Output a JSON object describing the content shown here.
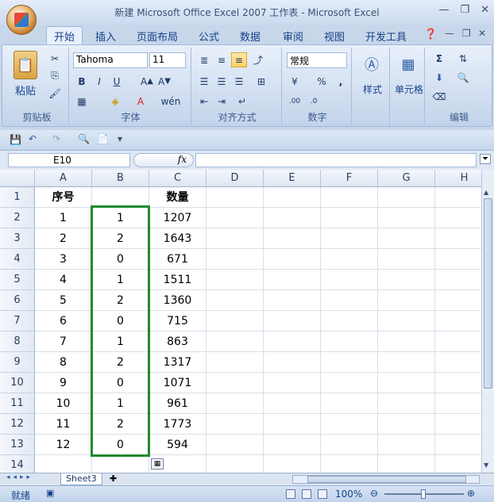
{
  "window": {
    "title": "新建 Microsoft Office Excel 2007 工作表 - Microsoft Excel"
  },
  "tabs": [
    "开始",
    "插入",
    "页面布局",
    "公式",
    "数据",
    "审阅",
    "视图",
    "开发工具"
  ],
  "ribbon": {
    "clipboard": {
      "label": "剪贴板",
      "paste": "粘贴"
    },
    "font": {
      "label": "字体",
      "name": "Tahoma",
      "size": "11"
    },
    "alignment": {
      "label": "对齐方式"
    },
    "number": {
      "label": "数字",
      "format": "常规"
    },
    "styles": {
      "label": "样式"
    },
    "cells": {
      "label": "单元格"
    },
    "editing": {
      "label": "编辑"
    }
  },
  "formula_bar": {
    "name_box": "E10",
    "fx": "fx",
    "formula": ""
  },
  "columns": [
    "A",
    "B",
    "C",
    "D",
    "E",
    "F",
    "G",
    "H"
  ],
  "rows": [
    [
      "1",
      "序号",
      "",
      "数量"
    ],
    [
      "2",
      "1",
      "1",
      "1207"
    ],
    [
      "3",
      "2",
      "2",
      "1643"
    ],
    [
      "4",
      "3",
      "0",
      "671"
    ],
    [
      "5",
      "4",
      "1",
      "1511"
    ],
    [
      "6",
      "5",
      "2",
      "1360"
    ],
    [
      "7",
      "6",
      "0",
      "715"
    ],
    [
      "8",
      "7",
      "1",
      "863"
    ],
    [
      "9",
      "8",
      "2",
      "1317"
    ],
    [
      "10",
      "9",
      "0",
      "1071"
    ],
    [
      "11",
      "10",
      "1",
      "961"
    ],
    [
      "12",
      "11",
      "2",
      "1773"
    ],
    [
      "13",
      "12",
      "0",
      "594"
    ],
    [
      "14",
      "",
      "",
      ""
    ]
  ],
  "sheet_tab": "Sheet3",
  "status": {
    "ready": "就绪",
    "zoom": "100%"
  }
}
